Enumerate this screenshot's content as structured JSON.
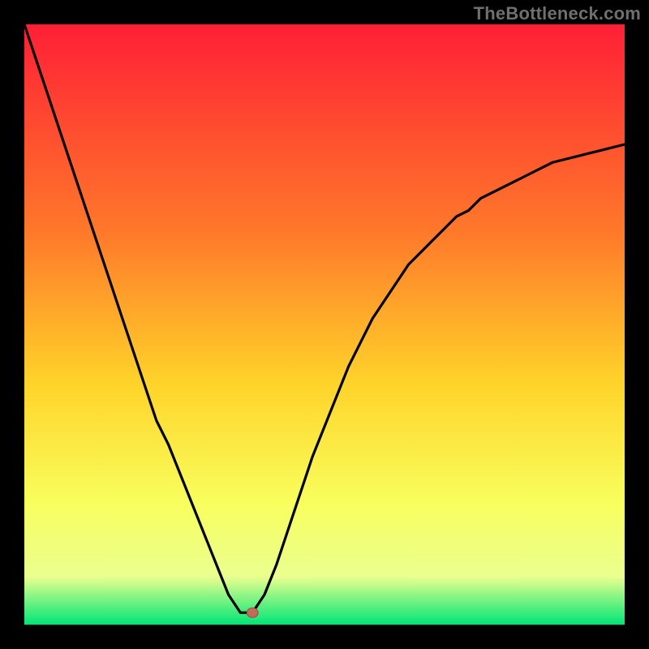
{
  "watermark": "TheBottleneck.com",
  "colors": {
    "background": "#000000",
    "gradient_top": "#ff1f36",
    "gradient_mid_upper": "#ff7a2a",
    "gradient_mid": "#ffd42a",
    "gradient_mid_lower": "#f8ff5e",
    "gradient_lower": "#eaff8f",
    "gradient_bottom": "#00e676",
    "curve": "#000000",
    "marker_fill": "#c46a5c",
    "marker_stroke": "#9a4a40"
  },
  "chart_data": {
    "type": "line",
    "title": "",
    "xlabel": "",
    "ylabel": "",
    "xlim": [
      0,
      100
    ],
    "ylim": [
      0,
      100
    ],
    "grid": false,
    "legend": false,
    "series": [
      {
        "name": "bottleneck-curve",
        "x": [
          0,
          2,
          4,
          6,
          8,
          10,
          12,
          14,
          16,
          18,
          20,
          22,
          24,
          26,
          28,
          30,
          32,
          34,
          36,
          38,
          40,
          42,
          44,
          46,
          48,
          50,
          52,
          54,
          56,
          58,
          60,
          62,
          64,
          66,
          68,
          70,
          72,
          74,
          76,
          78,
          80,
          82,
          84,
          86,
          88,
          90,
          92,
          94,
          96,
          98,
          100
        ],
        "y": [
          100,
          94,
          88,
          82,
          76,
          70,
          64,
          58,
          52,
          46,
          40,
          34,
          30,
          25,
          20,
          15,
          10,
          5,
          2,
          2,
          5,
          10,
          16,
          22,
          28,
          33,
          38,
          43,
          47,
          51,
          54,
          57,
          60,
          62,
          64,
          66,
          68,
          69,
          71,
          72,
          73,
          74,
          75,
          76,
          77,
          77.5,
          78,
          78.5,
          79,
          79.5,
          80
        ]
      }
    ],
    "marker": {
      "x": 38,
      "y": 2,
      "radius_px": 6
    }
  }
}
